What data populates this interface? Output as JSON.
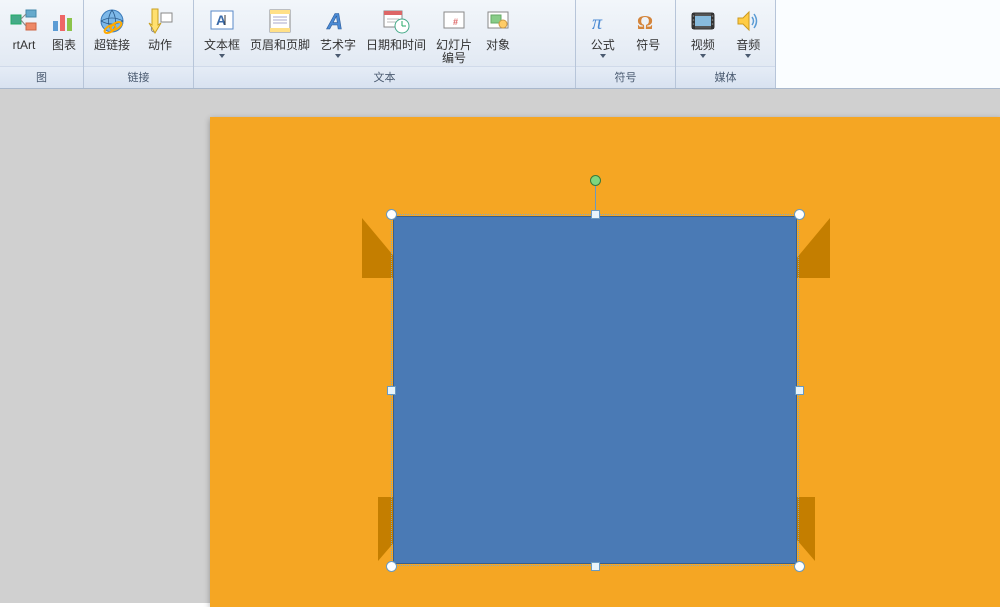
{
  "ribbon": {
    "group_illustrations": {
      "label": "图",
      "buttons": {
        "smartart": "rtArt",
        "chart": "图表"
      }
    },
    "group_links": {
      "label": "链接",
      "buttons": {
        "hyperlink": "超链接",
        "action": "动作"
      }
    },
    "group_text": {
      "label": "文本",
      "buttons": {
        "textbox": "文本框",
        "header_footer": "页眉和页脚",
        "wordart": "艺术字",
        "date_time": "日期和时间",
        "slide_number": "幻灯片\n编号",
        "object": "对象"
      }
    },
    "group_symbols": {
      "label": "符号",
      "buttons": {
        "equation": "公式",
        "symbol": "符号"
      }
    },
    "group_media": {
      "label": "媒体",
      "buttons": {
        "video": "视频",
        "audio": "音频"
      }
    }
  }
}
